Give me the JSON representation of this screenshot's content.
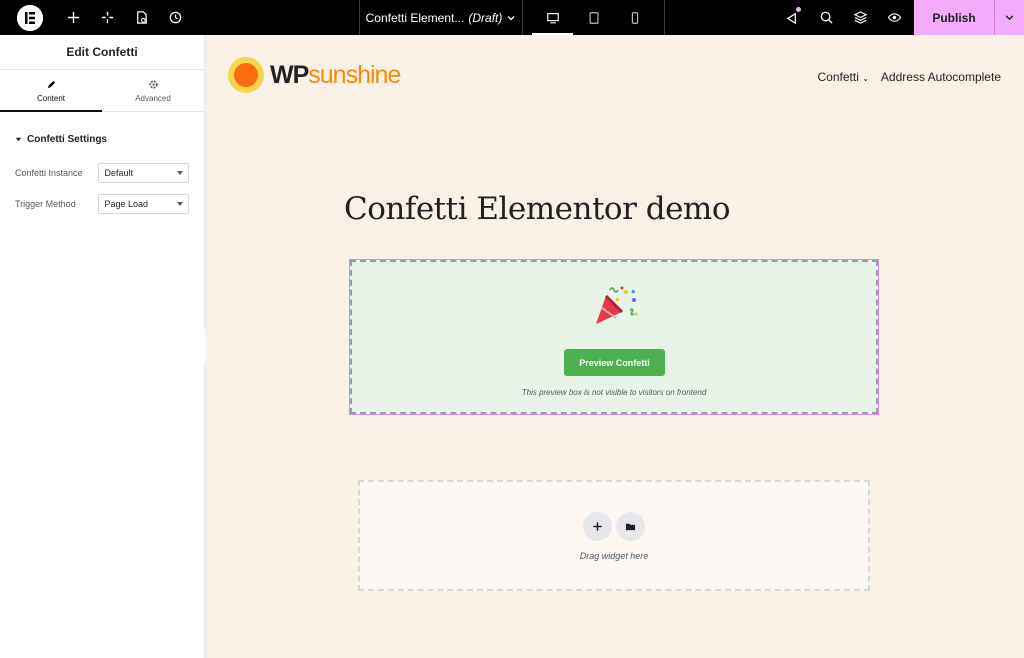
{
  "topbar": {
    "page_title": "Confetti Element...",
    "draft": "(Draft)",
    "publish": "Publish"
  },
  "panel": {
    "title": "Edit Confetti",
    "tabs": [
      {
        "label": "Content",
        "icon": "pencil-icon",
        "active": true
      },
      {
        "label": "Advanced",
        "icon": "gear-icon",
        "active": false
      }
    ],
    "section_title": "Confetti Settings",
    "controls": [
      {
        "label": "Confetti Instance",
        "value": "Default"
      },
      {
        "label": "Trigger Method",
        "value": "Page Load"
      }
    ]
  },
  "site": {
    "logo_wp": "WP",
    "logo_sunshine": "sunshine",
    "nav": [
      {
        "label": "Confetti"
      },
      {
        "label": "Address Autocomplete"
      }
    ]
  },
  "content": {
    "heading": "Confetti Elementor demo",
    "preview_button": "Preview Confetti",
    "preview_note": "This preview box is not visible to visitors on frontend",
    "drop_text": "Drag widget here"
  },
  "colors": {
    "publish": "#f0abfc",
    "canvas_bg": "#f9f0e6",
    "preview_bg": "#e6f3e6",
    "preview_button": "#4caf50",
    "logo_orange": "#f98909"
  }
}
